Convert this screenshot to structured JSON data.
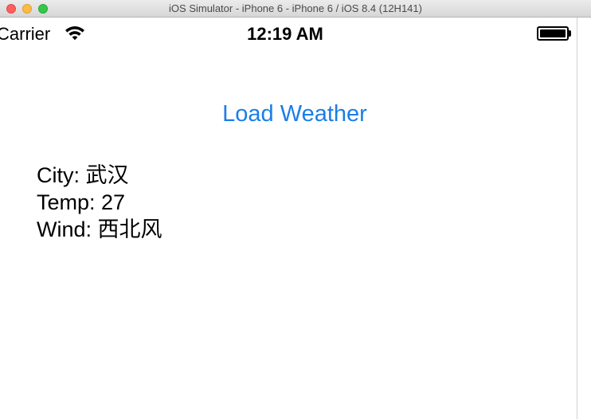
{
  "window": {
    "title": "iOS Simulator - iPhone 6 - iPhone 6 / iOS 8.4 (12H141)"
  },
  "status_bar": {
    "carrier": "Carrier",
    "time": "12:19 AM",
    "wifi_icon": "wifi-icon",
    "battery_icon": "battery-icon",
    "battery_level": 1.0
  },
  "main": {
    "load_button_label": "Load Weather",
    "city_label": "City: 武汉",
    "temp_label": "Temp: 27",
    "wind_label": "Wind: 西北风"
  },
  "colors": {
    "button_tint": "#1a7ee6",
    "text": "#000000",
    "background": "#ffffff"
  }
}
